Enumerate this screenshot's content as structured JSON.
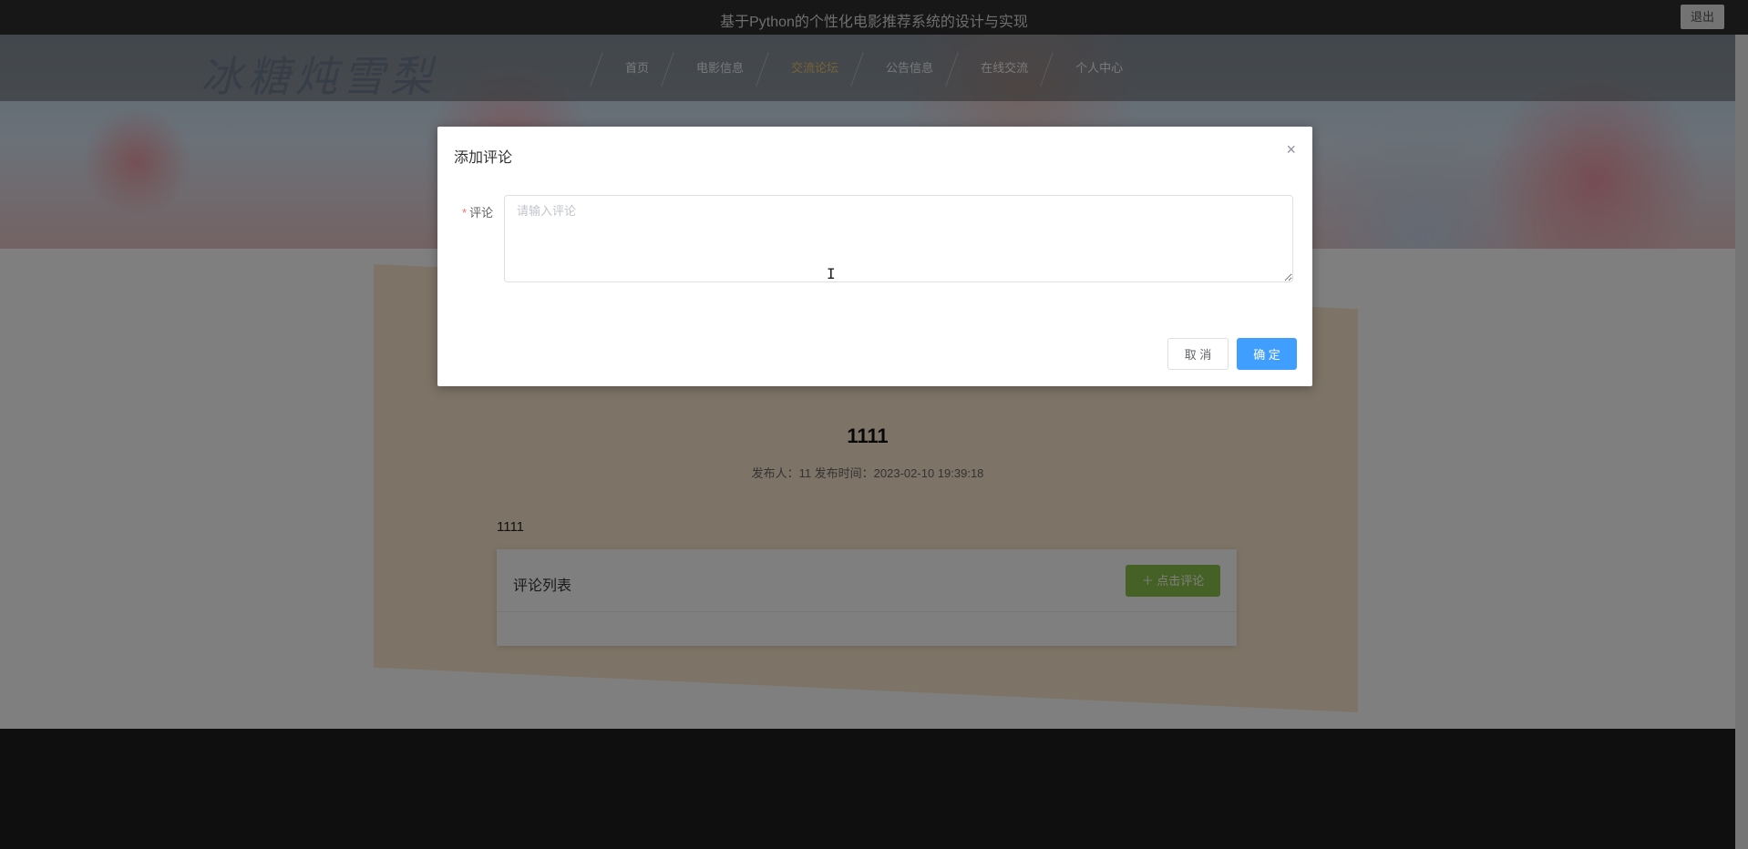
{
  "topbar": {
    "title": "基于Python的个性化电影推荐系统的设计与实现",
    "logout_label": "退出"
  },
  "brand": {
    "logo_text": "冰糖炖雪梨"
  },
  "nav": {
    "items": [
      {
        "label": "首页",
        "active": false
      },
      {
        "label": "电影信息",
        "active": false
      },
      {
        "label": "交流论坛",
        "active": true
      },
      {
        "label": "公告信息",
        "active": false
      },
      {
        "label": "在线交流",
        "active": false
      },
      {
        "label": "个人中心",
        "active": false
      }
    ]
  },
  "post": {
    "title": "1111",
    "meta": "发布人：11  发布时间：2023-02-10 19:39:18",
    "body": "1111"
  },
  "comments": {
    "list_title": "评论列表",
    "add_button_label": "＋ 点击评论"
  },
  "dialog": {
    "title": "添加评论",
    "close_symbol": "×",
    "field_required_mark": "*",
    "field_label": "评论",
    "textarea_placeholder": "请输入评论",
    "textarea_value": "",
    "cancel_label": "取 消",
    "ok_label": "确 定"
  },
  "colors": {
    "accent_blue": "#409eff",
    "comment_button_green": "#8bc34a",
    "required_red": "#f56c6c",
    "nav_active": "#e8c46a"
  }
}
